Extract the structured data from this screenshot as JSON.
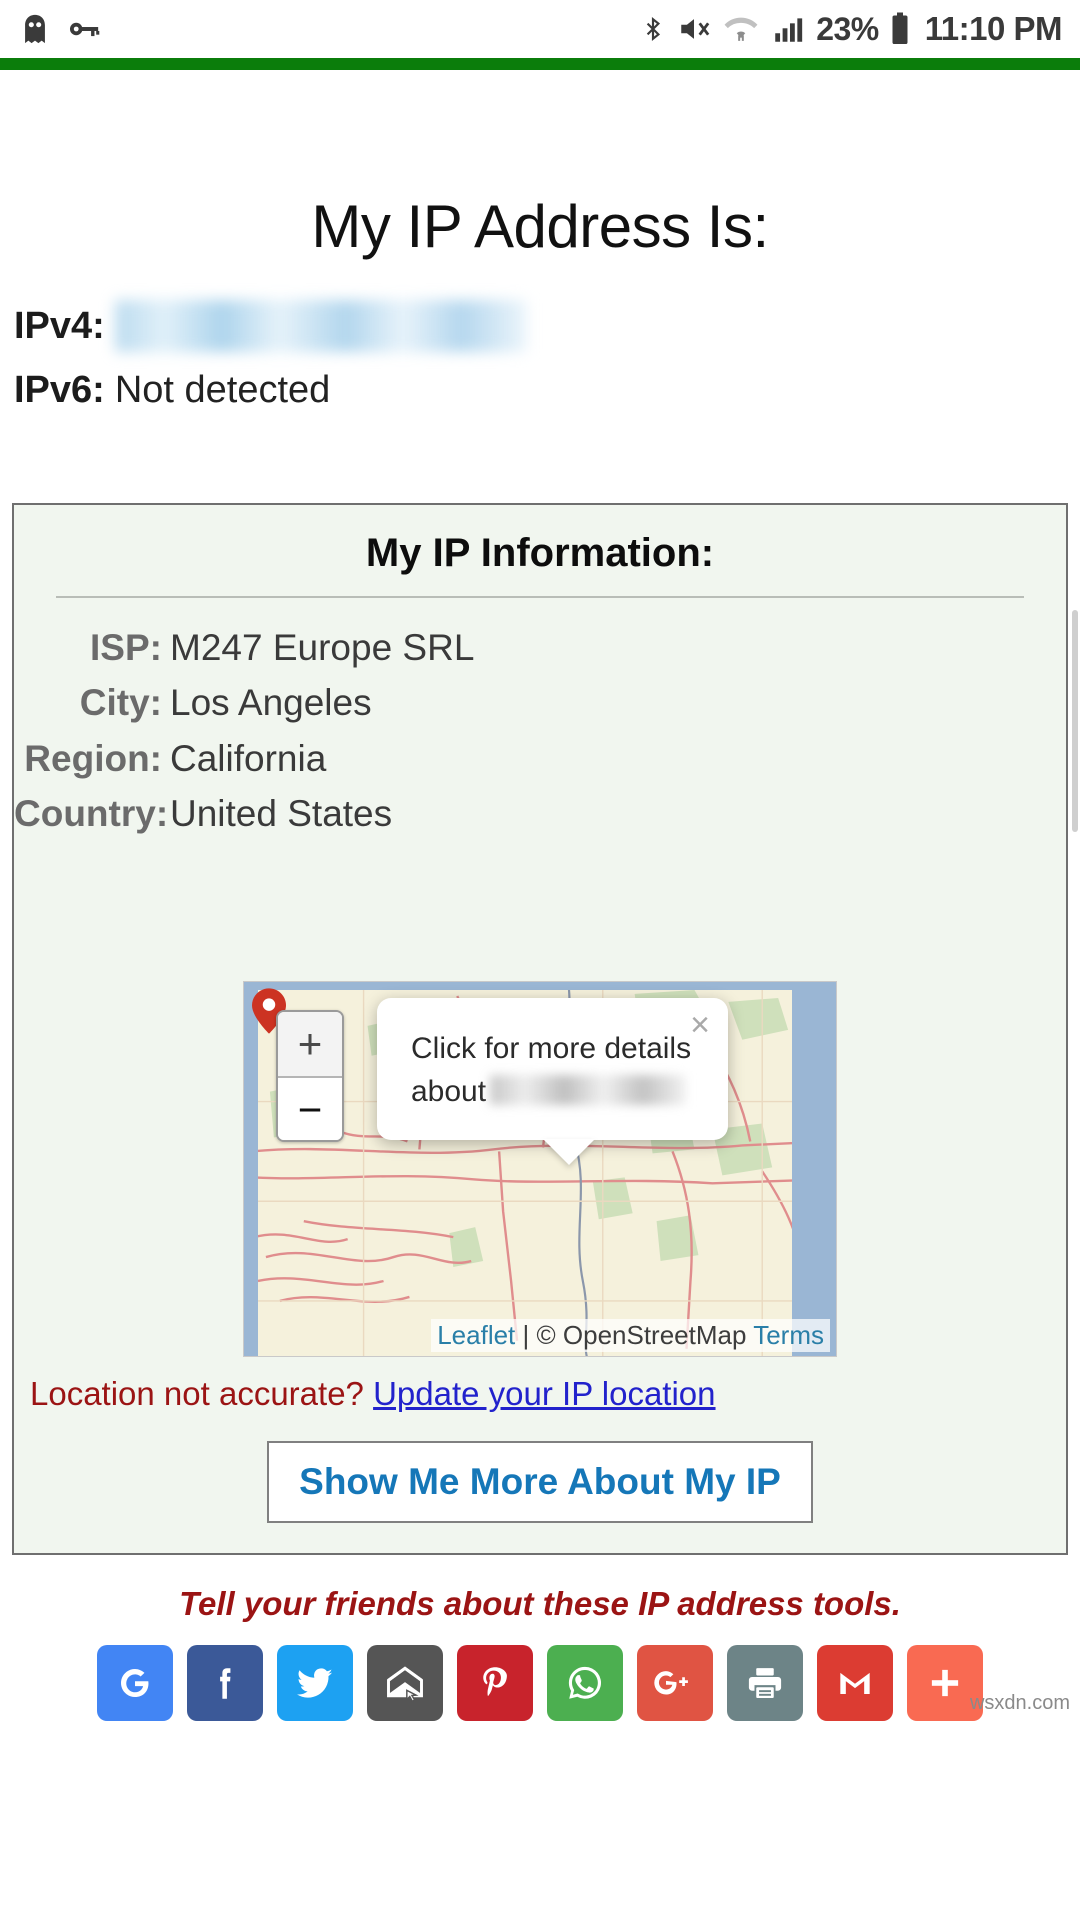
{
  "statusbar": {
    "battery_percent": "23%",
    "clock": "11:10 PM",
    "icons": [
      "ghost-icon",
      "key-icon",
      "bluetooth-icon",
      "mute-icon",
      "wifi-icon",
      "signal-icon",
      "battery-icon"
    ]
  },
  "page": {
    "title": "My IP Address Is:",
    "accent_green": "#0b7d0b"
  },
  "ip": {
    "ipv4_label": "IPv4:",
    "ipv4_value": "",
    "ipv6_label": "IPv6:",
    "ipv6_value": "Not detected"
  },
  "info_panel": {
    "heading": "My IP Information:",
    "rows": [
      {
        "label": "ISP:",
        "value": "M247 Europe SRL"
      },
      {
        "label": "City:",
        "value": "Los Angeles"
      },
      {
        "label": "Region:",
        "value": "California"
      },
      {
        "label": "Country:",
        "value": "United States"
      }
    ]
  },
  "map": {
    "zoom_in_label": "+",
    "zoom_out_label": "−",
    "marker_name": "location-marker",
    "popup": {
      "line1": "Click for more details",
      "line2": "about",
      "blurred_value": "",
      "close_label": "×"
    },
    "attribution": {
      "leaflet": "Leaflet",
      "separator": " | © ",
      "osm": "OpenStreetMap",
      "terms": "Terms"
    }
  },
  "location_notice": {
    "text": "Location not accurate?",
    "link": "Update your IP location"
  },
  "more_button": {
    "label": "Show Me More About My IP"
  },
  "share": {
    "tagline": "Tell your friends about these IP address tools.",
    "buttons": [
      {
        "name": "google-share-button",
        "glyph": "G",
        "color": "#4285f4"
      },
      {
        "name": "facebook-share-button",
        "glyph": "f",
        "color": "#3b5998"
      },
      {
        "name": "twitter-share-button",
        "glyph": "ᴠ",
        "color": "#1da1f2"
      },
      {
        "name": "email-share-button",
        "glyph": "✉",
        "color": "#555555"
      },
      {
        "name": "pinterest-share-button",
        "glyph": "ᵍF",
        "color": "#c8232c"
      },
      {
        "name": "whatsapp-share-button",
        "glyph": "☎",
        "color": "#4caf50"
      },
      {
        "name": "googleplus-share-button",
        "glyph": "G+",
        "color": "#e05443"
      },
      {
        "name": "print-share-button",
        "glyph": "⎙",
        "color": "#6d8487"
      },
      {
        "name": "gmail-share-button",
        "glyph": "M",
        "color": "#dc3c32"
      },
      {
        "name": "more-share-button",
        "glyph": "+",
        "color": "#f96a52"
      }
    ]
  },
  "watermark": "wsxdn.com"
}
